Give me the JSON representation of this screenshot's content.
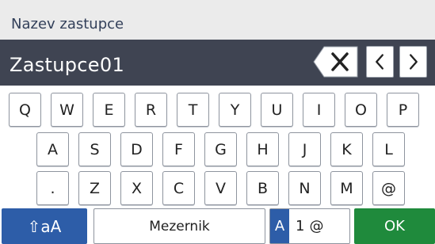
{
  "header": {
    "title": "Nazev zastupce"
  },
  "input": {
    "value": "Zastupce01",
    "backspace_icon": "backspace-icon",
    "cursor_left_icon": "chevron-left-icon",
    "cursor_right_icon": "chevron-right-icon"
  },
  "keyboard": {
    "row1": [
      "Q",
      "W",
      "E",
      "R",
      "T",
      "Y",
      "U",
      "I",
      "O",
      "P"
    ],
    "row2": [
      "A",
      "S",
      "D",
      "F",
      "G",
      "H",
      "J",
      "K",
      "L"
    ],
    "row3": [
      ".",
      "Z",
      "X",
      "C",
      "V",
      "B",
      "N",
      "M",
      "@"
    ],
    "shift_label": "⇧aA",
    "space_label": "Mezernik",
    "mode": {
      "active": "A",
      "rest": "1@"
    },
    "ok_label": "OK"
  },
  "colors": {
    "header_bg": "#ebebeb",
    "input_bg": "#3f4452",
    "shift_bg": "#2d5da8",
    "ok_bg": "#1f8a3c"
  }
}
